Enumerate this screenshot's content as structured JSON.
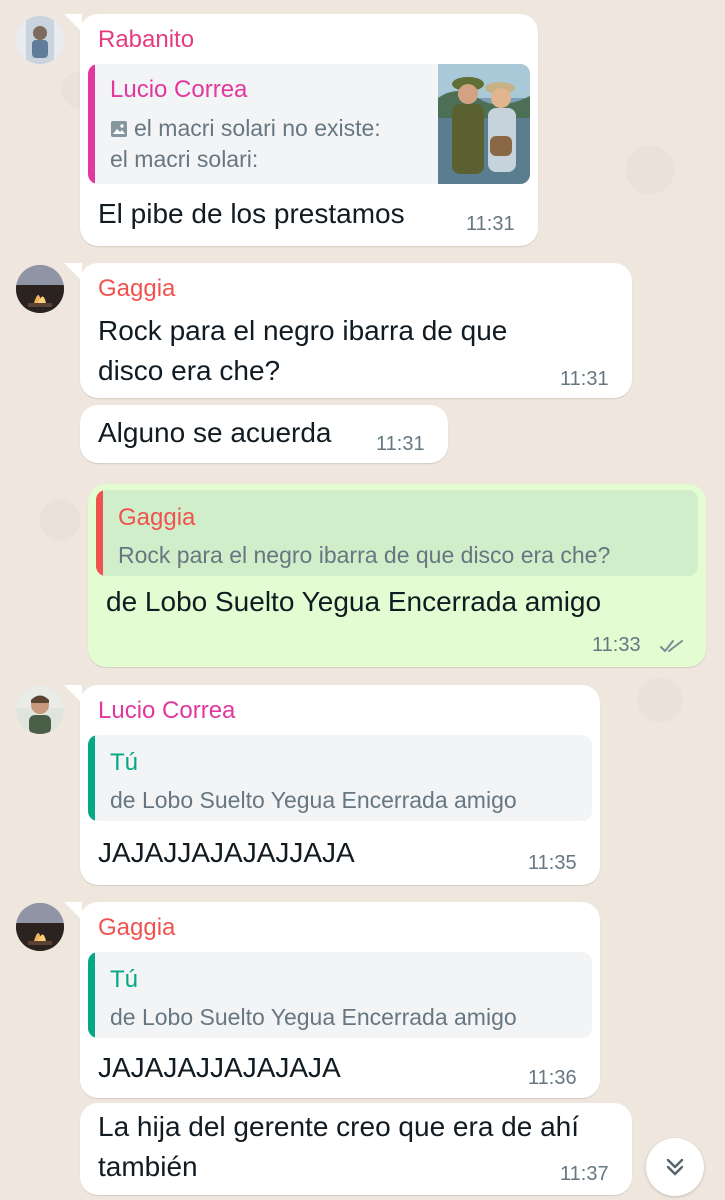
{
  "messages": [
    {
      "sender": "Rabanito",
      "quote": {
        "name": "Lucio Correa",
        "text": "el macri solari no existe:\nel macri solari:"
      },
      "text": "El pibe de los prestamos",
      "time": "11:31"
    },
    {
      "sender": "Gaggia",
      "text": "Rock para el negro ibarra de que\ndisco era che?",
      "time": "11:31"
    },
    {
      "text": "Alguno se acuerda",
      "time": "11:31"
    },
    {
      "quote": {
        "name": "Gaggia",
        "text": "Rock para el negro ibarra de que disco era che?"
      },
      "text": "de Lobo Suelto Yegua Encerrada amigo",
      "time": "11:33"
    },
    {
      "sender": "Lucio Correa",
      "quote": {
        "name": "Tú",
        "text": "de Lobo Suelto Yegua Encerrada amigo"
      },
      "text": "JAJAJJAJAJAJJAJA",
      "time": "11:35"
    },
    {
      "sender": "Gaggia",
      "quote": {
        "name": "Tú",
        "text": "de Lobo Suelto Yegua Encerrada amigo"
      },
      "text": "JAJAJAJJAJAJAJA",
      "time": "11:36"
    },
    {
      "text": "La hija del gerente creo que era de ahí\ntambién",
      "time": "11:37"
    }
  ],
  "colors": {
    "rabanito": "#e33d7f",
    "lucio": "#e0389f",
    "gaggia": "#ef5350",
    "you": "#05a884",
    "outgoing_bubble": "#e3fcd2",
    "incoming_bubble": "#ffffff",
    "meta_text": "#667781",
    "read_ticks": "#7d8d96"
  },
  "icons": {
    "quoted_photo": "image-icon",
    "message_status": "double-check-icon",
    "scroll_down": "double-chevron-down-icon"
  }
}
